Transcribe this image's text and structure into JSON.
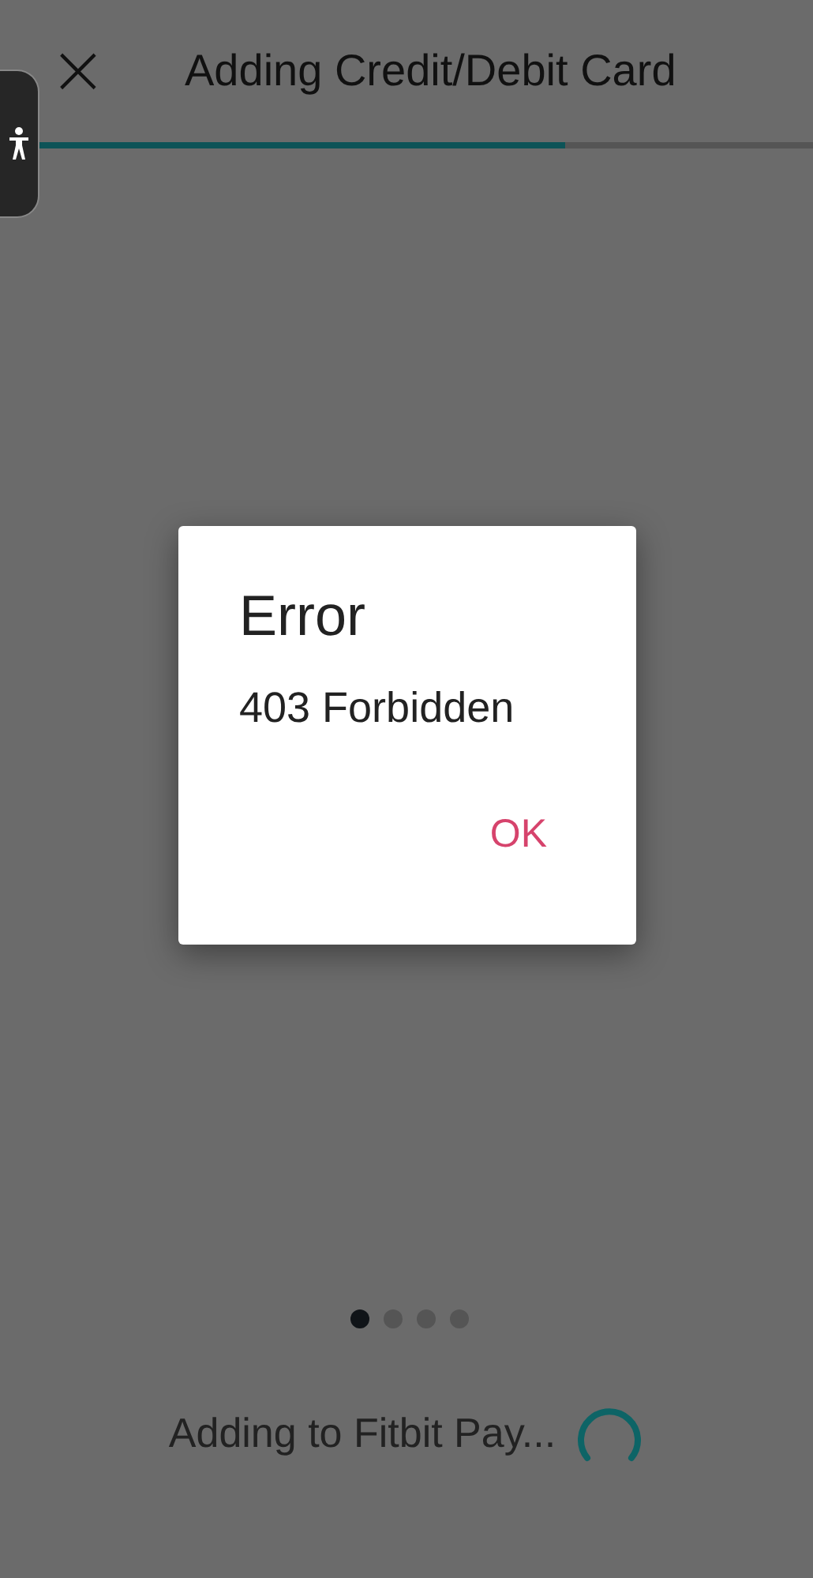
{
  "header": {
    "close": "×",
    "title": "Adding Credit/Debit Card"
  },
  "progress": {
    "level": 0.68
  },
  "dialog": {
    "title": "Error",
    "message": "403 Forbidden",
    "button": "OK"
  },
  "pager": [
    {
      "selected": true
    },
    {
      "selected": false
    },
    {
      "selected": false
    },
    {
      "selected": false
    }
  ],
  "status": {
    "text": "Adding to Fitbit Pay..."
  }
}
